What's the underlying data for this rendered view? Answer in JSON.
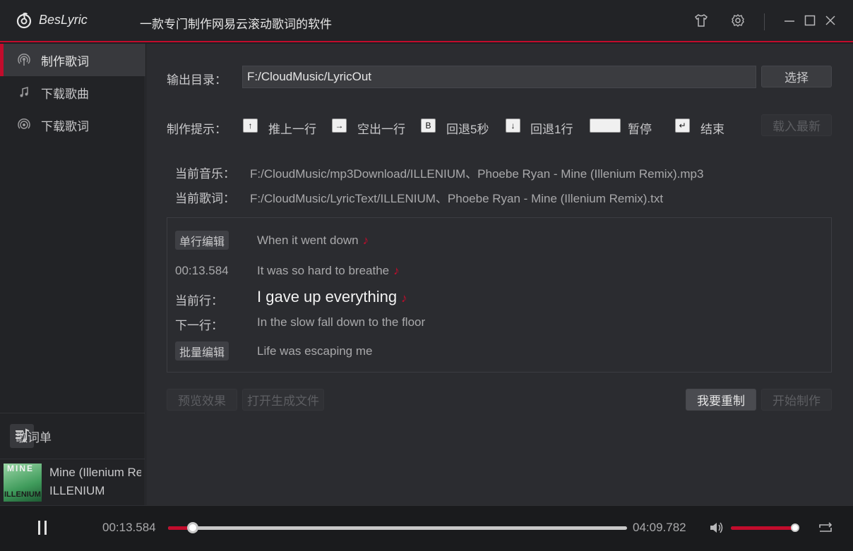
{
  "app": {
    "name": "BesLyric",
    "subtitle": "一款专门制作网易云滚动歌词的软件"
  },
  "colors": {
    "accent": "#c20c2c",
    "bg": "#2b2c30",
    "sidebar": "#222326"
  },
  "titlebar": {
    "icons": [
      "shirt-icon",
      "gear-icon",
      "minimize-icon",
      "maximize-icon",
      "close-icon"
    ]
  },
  "sidebar": {
    "items": [
      {
        "label": "制作歌词",
        "icon": "podcast-icon",
        "active": true
      },
      {
        "label": "下载歌曲",
        "icon": "music-note-icon",
        "active": false
      },
      {
        "label": "下载歌词",
        "icon": "radio-icon",
        "active": false
      }
    ],
    "lyric_list_label": "歌词单",
    "now_playing": {
      "title": "Mine (Illenium Remix)",
      "artist": "ILLENIUM",
      "cover_text_top": "MINE",
      "cover_text_bottom": "ILLENIUM"
    }
  },
  "main": {
    "output_label": "输出目录：",
    "output_value": "F:/CloudMusic/LyricOut",
    "choose_button": "选择",
    "hint_label": "制作提示：",
    "hints": [
      {
        "key": "↑",
        "text": "推上一行"
      },
      {
        "key": "→",
        "text": "空出一行"
      },
      {
        "key": "B",
        "text": "回退5秒"
      },
      {
        "key": "↓",
        "text": "回退1行"
      },
      {
        "key": "",
        "text": "暂停"
      },
      {
        "key": "↵",
        "text": "结束"
      }
    ],
    "load_latest_button": "载入最新",
    "current_music_label": "当前音乐：",
    "current_music_value": "F:/CloudMusic/mp3Download/ILLENIUM、Phoebe Ryan - Mine (Illenium Remix).mp3",
    "current_lyric_label": "当前歌词：",
    "current_lyric_value": "F:/CloudMusic/LyricText/ILLENIUM、Phoebe Ryan - Mine (Illenium Remix).txt",
    "panel": {
      "single_edit": "单行编辑",
      "batch_edit": "批量编辑",
      "timestamp": "00:13.584",
      "current_label": "当前行：",
      "next_label": "下一行：",
      "lines": [
        "When it went down",
        "It was so hard to breathe",
        "I gave up everything",
        "In the slow fall down to the floor",
        "Life was escaping me"
      ],
      "note_glyph": "♪"
    },
    "preview_button": "预览效果",
    "open_file_button": "打开生成文件",
    "reset_button": "我要重制",
    "start_button": "开始制作"
  },
  "player": {
    "elapsed": "00:13.584",
    "total": "04:09.782",
    "progress_fraction": 0.054,
    "volume_fraction": 0.95
  }
}
